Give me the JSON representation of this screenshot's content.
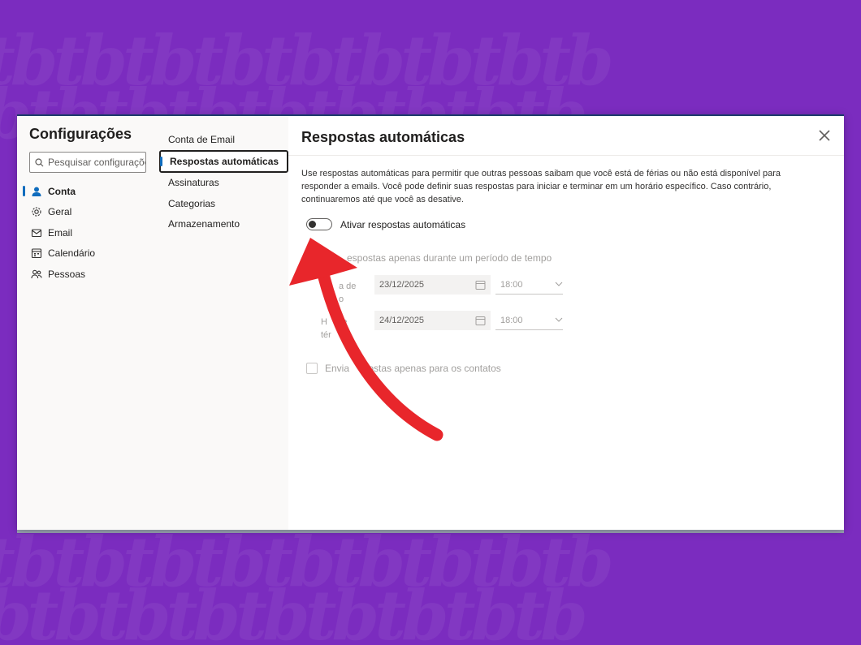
{
  "settings": {
    "title": "Configurações",
    "search_placeholder": "Pesquisar configurações",
    "nav": [
      {
        "label": "Conta",
        "icon": "person-icon",
        "active": true
      },
      {
        "label": "Geral",
        "icon": "gear-icon",
        "active": false
      },
      {
        "label": "Email",
        "icon": "mail-icon",
        "active": false
      },
      {
        "label": "Calendário",
        "icon": "calendar-icon",
        "active": false
      },
      {
        "label": "Pessoas",
        "icon": "people-icon",
        "active": false
      }
    ]
  },
  "subnav": [
    {
      "label": "Conta de Email",
      "active": false
    },
    {
      "label": "Respostas automáticas",
      "active": true
    },
    {
      "label": "Assinaturas",
      "active": false
    },
    {
      "label": "Categorias",
      "active": false
    },
    {
      "label": "Armazenamento",
      "active": false
    }
  ],
  "pane": {
    "title": "Respostas automáticas",
    "close_icon": "close-icon",
    "description": "Use respostas automáticas para permitir que outras pessoas saibam que você está de férias ou não está disponível para responder a emails. Você pode definir suas respostas para iniciar e terminar em um horário específico. Caso contrário, continuaremos até que você as desative.",
    "toggle_label": "Ativar respostas automáticas",
    "toggle_on": false,
    "period_label_visible": "espostas apenas durante um período de tempo",
    "start": {
      "label_visible": "a de\no",
      "date": "23/12/2025",
      "time": "18:00"
    },
    "end": {
      "label_visible": "H    de\ntér",
      "date": "24/12/2025",
      "time": "18:00"
    },
    "contacts_label_visible": "Envia       ostas apenas para os contatos"
  },
  "overlay": {
    "arrow_color": "#e8262b",
    "pattern_text": "tbtbtbtbtbtbtbtbtb"
  },
  "colors": {
    "background": "#7b2cbf",
    "accent": "#0f6cbd"
  }
}
